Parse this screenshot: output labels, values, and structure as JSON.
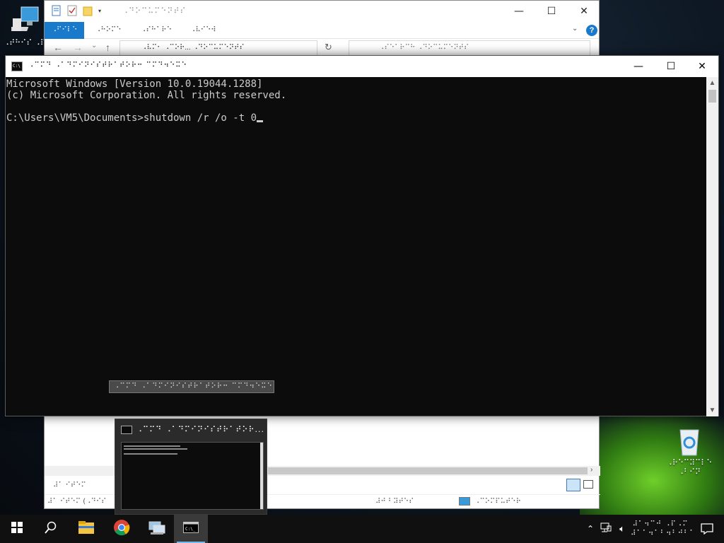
{
  "desktop": {
    "icons": [
      {
        "label": "⠠⠞⠓⠊⠎ ⠠⠏⠉"
      },
      {
        "label": "⠠⠗⠑⠉⠽⠉⠇⠑ ⠠⠃⠊⠝"
      }
    ]
  },
  "explorer": {
    "title": "⠠⠙⠕⠉⠥⠍⠑⠝⠞⠎",
    "tabs": [
      "⠠⠋⠊⠇⠑",
      "⠠⠓⠕⠍⠑",
      "⠠⠎⠓⠁⠗⠑",
      "⠠⠧⠊⠑⠺"
    ],
    "address": "⠠⠧⠍⠂ ⠠⠉⠕⠗...  ⠠⠙⠕⠉⠥⠍⠑⠝⠞⠎",
    "search_placeholder": "⠠⠎⠑⠁⠗⠉⠓ ⠠⠙⠕⠉⠥⠍⠑⠝⠞⠎",
    "items_count": "⠼⠁ ⠊⠞⠑⠍",
    "status_left": "⠼⠁ ⠊⠞⠑⠍ (⠠⠙⠊⠎",
    "status_mid": "⠼⠚ ⠃⠽⠞⠑⠎",
    "status_right": "⠠⠉⠕⠍⠏⠥⠞⠑⠗"
  },
  "cmd": {
    "title": "⠠⠉⠍⠙ ⠠⠁⠙⠍⠊⠝⠊⠎⠞⠗⠁⠞⠕⠗⠒ ⠉⠍⠙⠲⠑⠭⠑",
    "lines": [
      "Microsoft Windows [Version 10.0.19044.1288]",
      "(c) Microsoft Corporation. All rights reserved.",
      "",
      "C:\\Users\\VM5\\Documents>shutdown /r /o -t 0"
    ],
    "tooltip": "⠠⠉⠍⠙ ⠠⠁⠙⠍⠊⠝⠊⠎⠞⠗⠁⠞⠕⠗⠒ ⠉⠍⠙⠲⠑⠭⠑"
  },
  "thumbnail": {
    "title": "⠠⠉⠍⠙ ⠠⠁⠙⠍⠊⠝⠊⠎⠞⠗⠁⠞⠕⠗..."
  },
  "taskbar": {
    "apps": [
      "start-icon",
      "search-icon",
      "file-explorer-icon",
      "chrome-icon",
      "network-computer-icon",
      "cmd-icon"
    ],
    "clock_time": "⠼⠁⠲⠉⠚ ⠠⠏⠠⠍",
    "clock_date": "⠼⠁⠁⠲⠁⠃⠲⠃⠚⠃⠁"
  },
  "colors": {
    "accent": "#1979ca",
    "console_bg": "#0c0c0c",
    "console_fg": "#cccccc",
    "taskbar_bg": "#101010"
  }
}
